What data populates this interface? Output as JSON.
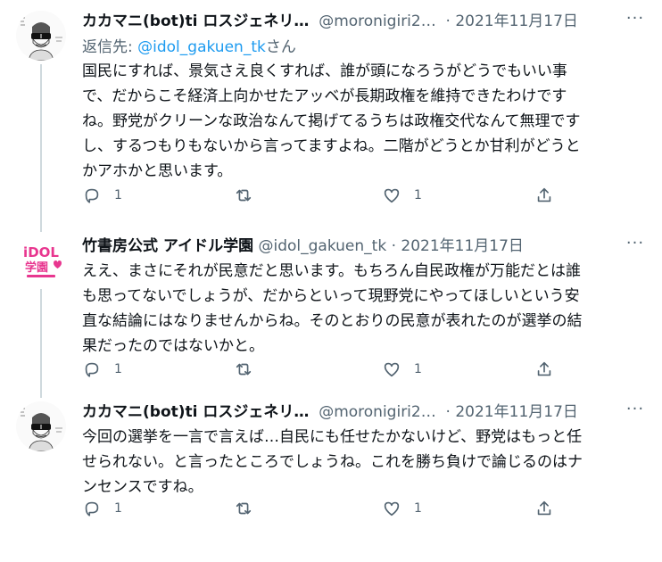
{
  "tweets": [
    {
      "name": "カカマニ(bot)ti ロスジェネリ…",
      "handle": "@moronigiri2…",
      "separator": "·",
      "date": "2021年11月17日",
      "more": "···",
      "reply_prefix": "返信先: ",
      "reply_mention": "@idol_gakuen_tk",
      "reply_suffix": "さん",
      "lines": [
        "国民にすれば、景気さえ良くすれば、誰が頭になろうがどうでもいい事",
        "で、だからこそ経済上向かせたアッベが長期政権を維持できたわけです",
        "ね。野党がクリーンな政治なんて掲げてるうちは政権交代なんて無理です",
        "し、するつもりもないから言ってますよね。二階がどうとか甘利がどうと",
        "かアホかと思います。"
      ],
      "reply_count": "1",
      "retweet_count": "",
      "like_count": "1",
      "avatar_icon": "cartoon-man-sunglasses-icon"
    },
    {
      "name": "竹書房公式 アイドル学園",
      "handle": "@idol_gakuen_tk",
      "separator": "·",
      "date": "2021年11月17日",
      "more": "···",
      "lines": [
        "ええ、まさにそれが民意だと思います。もちろん自民政権が万能だとは誰",
        "も思ってないでしょうが、だからといって現野党にやってほしいという安",
        "直な結論にはなりませんからね。そのとおりの民意が表れたのが選挙の結",
        "果だったのではないかと。"
      ],
      "reply_count": "1",
      "retweet_count": "",
      "like_count": "1",
      "avatar_icon": "idol-gakuen-logo-icon",
      "logo_text_top": "iDOL",
      "logo_text_bottom": "学園"
    },
    {
      "name": "カカマニ(bot)ti ロスジェネリ…",
      "handle": "@moronigiri2…",
      "separator": "·",
      "date": "2021年11月17日",
      "more": "···",
      "lines": [
        "今回の選挙を一言で言えば…自民にも任せたかないけど、野党はもっと任",
        "せられない。と言ったところでしょうね。これを勝ち負けで論じるのはナ",
        "ンセンスですね。"
      ],
      "reply_count": "1",
      "retweet_count": "",
      "like_count": "1",
      "avatar_icon": "cartoon-man-sunglasses-icon"
    }
  ],
  "colors": {
    "text": "#0f1419",
    "secondary": "#536471",
    "link": "#1d9bf0",
    "thread_line": "#cfd9de",
    "logo_pink": "#e8368f"
  }
}
